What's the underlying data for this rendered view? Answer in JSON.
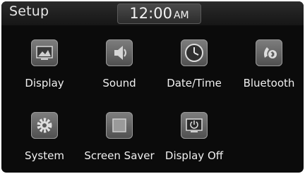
{
  "header": {
    "title": "Setup",
    "time": "12:00",
    "ampm": "AM"
  },
  "apps": [
    {
      "label": "Display",
      "icon": "display-icon"
    },
    {
      "label": "Sound",
      "icon": "speaker-icon"
    },
    {
      "label": "Date/Time",
      "icon": "clock-icon"
    },
    {
      "label": "Bluetooth",
      "icon": "bluetooth-phone-icon"
    },
    {
      "label": "System",
      "icon": "gear-icon"
    },
    {
      "label": "Screen Saver",
      "icon": "screen-saver-icon"
    },
    {
      "label": "Display Off",
      "icon": "display-off-icon"
    }
  ]
}
